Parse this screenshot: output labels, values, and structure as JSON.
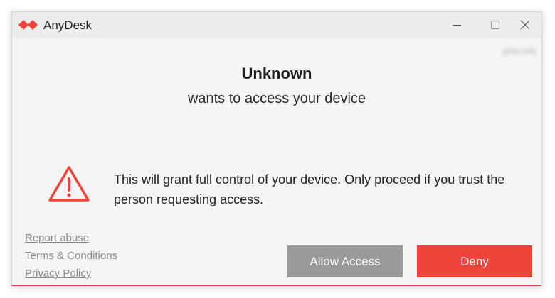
{
  "window": {
    "title": "AnyDesk",
    "device_id": "g5fw1l4lj"
  },
  "titlebar_icons": [
    "anydesk-logo-icon",
    "minimize-icon",
    "maximize-icon",
    "close-icon"
  ],
  "request": {
    "requester": "Unknown",
    "message": "wants to access your device"
  },
  "warning": {
    "icon": "warning-icon",
    "text": "This will grant full control of your device. Only proceed if you trust the person requesting access."
  },
  "links": {
    "report_abuse": "Report abuse",
    "terms": "Terms & Conditions",
    "privacy": "Privacy Policy"
  },
  "actions": {
    "allow_label": "Allow Access",
    "deny_label": "Deny"
  },
  "colors": {
    "brand": "#ef443b",
    "allow_button": "#9a9a9a",
    "link": "#8a8a8a"
  }
}
